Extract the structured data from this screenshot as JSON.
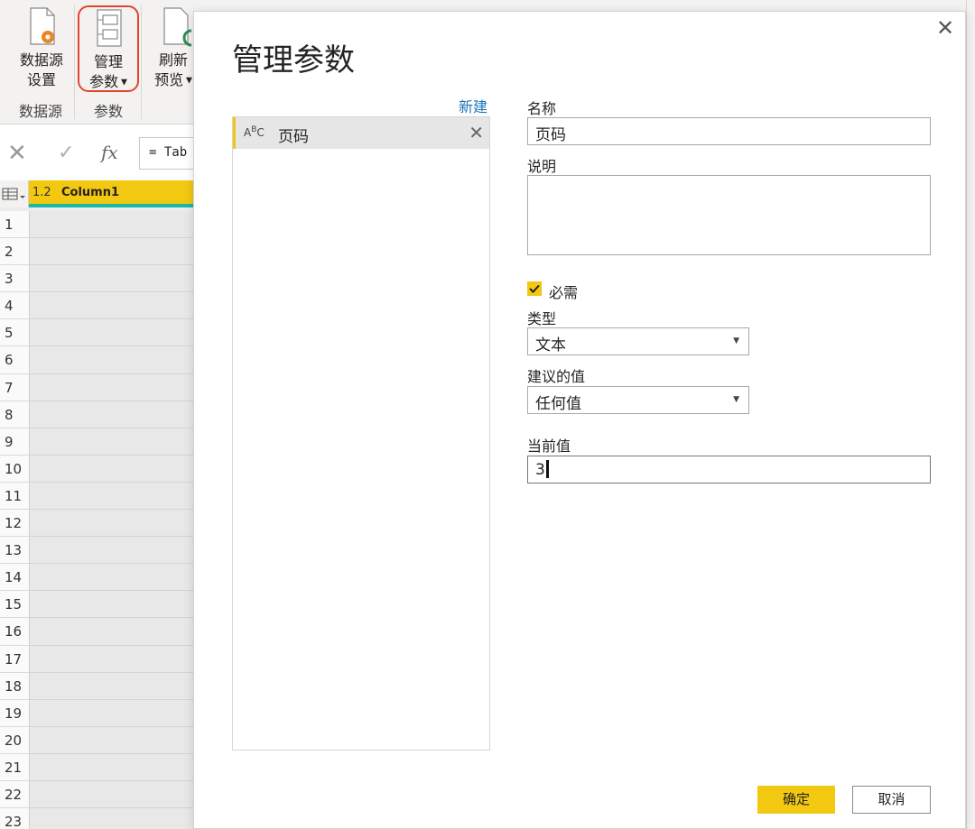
{
  "ribbon": {
    "buttons": [
      {
        "line1": "数据源",
        "line2": "设置"
      },
      {
        "line1": "管理",
        "line2": "参数"
      },
      {
        "line1": "刷新",
        "line2": "预览"
      }
    ],
    "groups": {
      "datasource": "数据源",
      "params": "参数"
    }
  },
  "formula_bar": {
    "text": "= Tab",
    "fx": "fx"
  },
  "grid": {
    "column_type": "1.2",
    "column_name": "Column1",
    "row_numbers": [
      "1",
      "2",
      "3",
      "4",
      "5",
      "6",
      "7",
      "8",
      "9",
      "10",
      "11",
      "12",
      "13",
      "14",
      "15",
      "16",
      "17",
      "18",
      "19",
      "20",
      "21",
      "22",
      "23"
    ]
  },
  "dialog": {
    "title": "管理参数",
    "new_link": "新建",
    "parameters": [
      {
        "type_icon": "ABC",
        "name": "页码"
      }
    ],
    "form": {
      "name_label": "名称",
      "name_value": "页码",
      "desc_label": "说明",
      "desc_value": "",
      "required_label": "必需",
      "required_checked": true,
      "type_label": "类型",
      "type_value": "文本",
      "suggested_label": "建议的值",
      "suggested_value": "任何值",
      "current_label": "当前值",
      "current_value": "3"
    },
    "ok_label": "确定",
    "cancel_label": "取消"
  },
  "colors": {
    "accent": "#f2c811",
    "link": "#1b75bc",
    "highlight_border": "#e2452c",
    "teal": "#19b9a8"
  }
}
